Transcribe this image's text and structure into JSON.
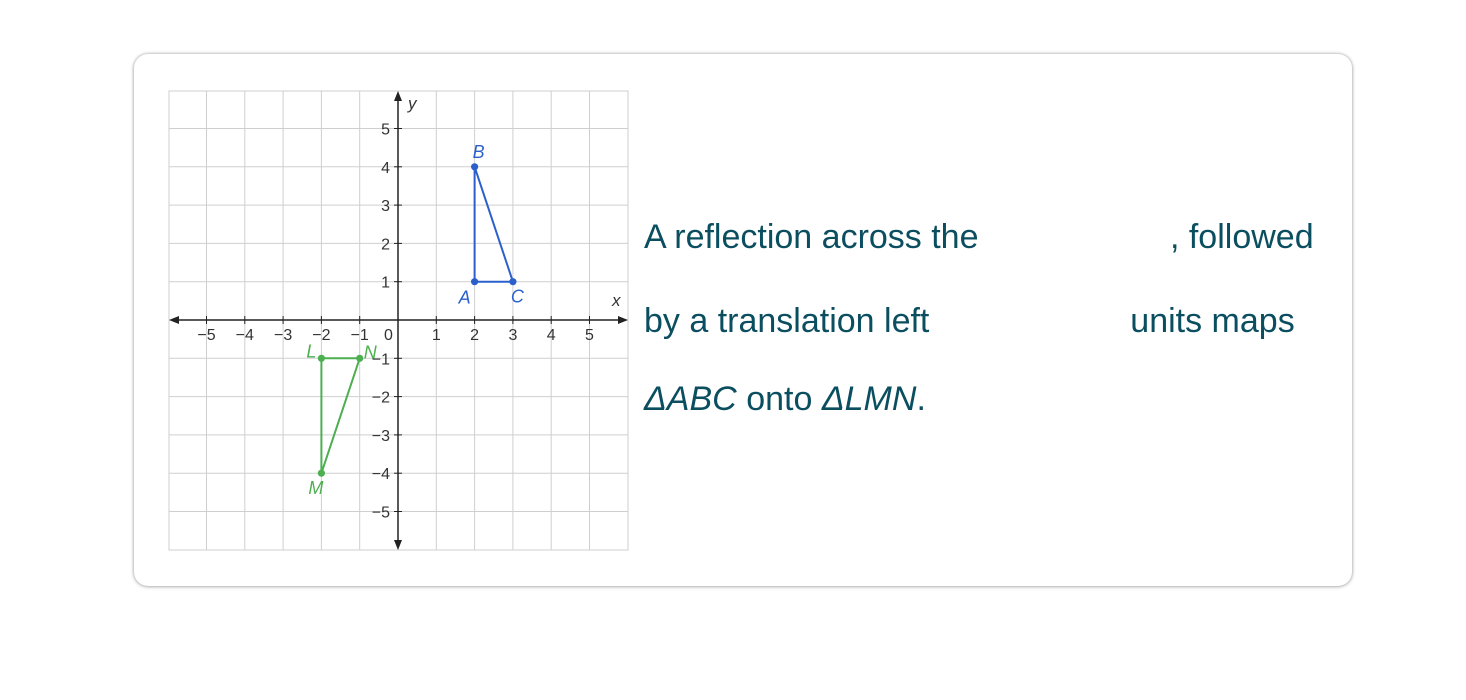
{
  "graph": {
    "x_axis_label": "x",
    "y_axis_label": "y",
    "x_ticks": [
      "−5",
      "−4",
      "−3",
      "−2",
      "−1",
      "1",
      "2",
      "3",
      "4",
      "5"
    ],
    "y_ticks": [
      "5",
      "4",
      "3",
      "2",
      "1",
      "−1",
      "−2",
      "−3",
      "−4",
      "−5"
    ],
    "x_tick_values": [
      -5,
      -4,
      -3,
      -2,
      -1,
      1,
      2,
      3,
      4,
      5
    ],
    "y_tick_values": [
      5,
      4,
      3,
      2,
      1,
      -1,
      -2,
      -3,
      -4,
      -5
    ],
    "origin_label": "0",
    "range": {
      "xmin": -6,
      "xmax": 6,
      "ymin": -6,
      "ymax": 6
    },
    "triangles": [
      {
        "name": "ABC",
        "color": "#2b5fcc",
        "points": [
          {
            "label": "A",
            "x": 2,
            "y": 1
          },
          {
            "label": "B",
            "x": 2,
            "y": 4
          },
          {
            "label": "C",
            "x": 3,
            "y": 1
          }
        ]
      },
      {
        "name": "LMN",
        "color": "#4caf50",
        "points": [
          {
            "label": "L",
            "x": -2,
            "y": -1
          },
          {
            "label": "M",
            "x": -2,
            "y": -4
          },
          {
            "label": "N",
            "x": -1,
            "y": -1
          }
        ]
      }
    ]
  },
  "problem": {
    "line1_before": "A reflection across the",
    "line1_after": ", followed",
    "line2_before": "by a translation left",
    "line2_after": "units maps",
    "tri1": "ΔABC",
    "onto": "onto",
    "tri2": "ΔLMN",
    "period": "."
  }
}
